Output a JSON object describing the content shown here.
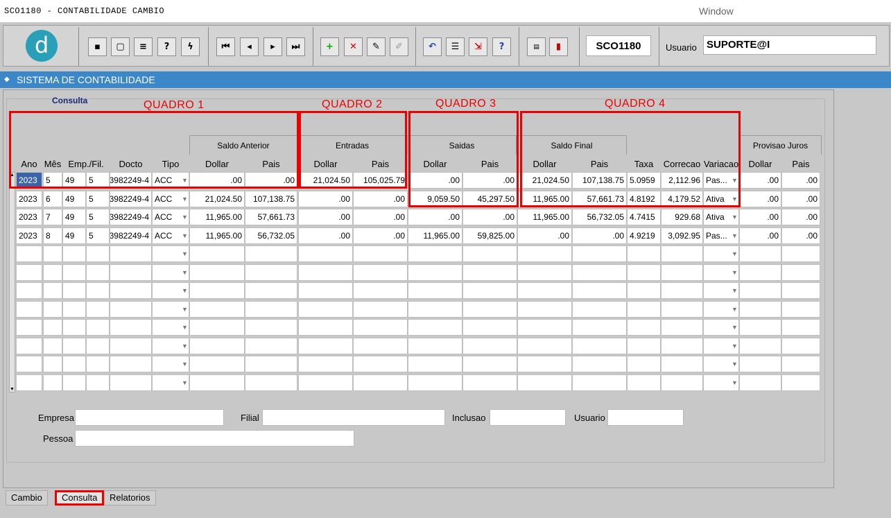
{
  "app_title": "SCO1180 - CONTABILIDADE CAMBIO",
  "window_menu": "Window",
  "toolbar": {
    "form_code": "SCO1180",
    "user_label": "Usuario",
    "user_value": "SUPORTE@I",
    "buttons": [
      "save-icon",
      "print-preview-icon",
      "printer-icon",
      "query-help-icon",
      "execute-query-icon",
      "first-record-icon",
      "previous-record-icon",
      "next-record-icon",
      "last-record-icon",
      "insert-record-icon",
      "delete-record-icon",
      "edit-record-icon",
      "clear-icon",
      "undo-icon",
      "list-icon",
      "exit-form-icon",
      "help-icon",
      "menu-icon",
      "door-exit-icon"
    ]
  },
  "banner_title": "SISTEMA DE CONTABILIDADE",
  "section_label": "Consulta",
  "quadros": [
    "QUADRO 1",
    "QUADRO 2",
    "QUADRO 3",
    "QUADRO 4"
  ],
  "group_headers": [
    "Saldo Anterior",
    "Entradas",
    "Saidas",
    "Saldo Final",
    "Provisao Juros"
  ],
  "columns": [
    "Ano",
    "Mês",
    "Emp./Fil.",
    "Docto",
    "Tipo",
    "Dollar",
    "Pais",
    "Dollar",
    "Pais",
    "Dollar",
    "Pais",
    "Dollar",
    "Pais",
    "Taxa",
    "Correcao",
    "Variacao",
    "Dollar",
    "Pais"
  ],
  "rows": [
    [
      "2023",
      "5",
      "49",
      "5",
      "3982249-4",
      "ACC",
      ".00",
      ".00",
      "21,024.50",
      "105,025.79",
      ".00",
      ".00",
      "21,024.50",
      "107,138.75",
      "5.0959",
      "2,112.96",
      "Pas...",
      ".00",
      ".00"
    ],
    [
      "2023",
      "6",
      "49",
      "5",
      "3982249-4",
      "ACC",
      "21,024.50",
      "107,138.75",
      ".00",
      ".00",
      "9,059.50",
      "45,297.50",
      "11,965.00",
      "57,661.73",
      "4.8192",
      "4,179.52",
      "Ativa",
      ".00",
      ".00"
    ],
    [
      "2023",
      "7",
      "49",
      "5",
      "3982249-4",
      "ACC",
      "11,965.00",
      "57,661.73",
      ".00",
      ".00",
      ".00",
      ".00",
      "11,965.00",
      "56,732.05",
      "4.7415",
      "929.68",
      "Ativa",
      ".00",
      ".00"
    ],
    [
      "2023",
      "8",
      "49",
      "5",
      "3982249-4",
      "ACC",
      "11,965.00",
      "56,732.05",
      ".00",
      ".00",
      "11,965.00",
      "59,825.00",
      ".00",
      ".00",
      "4.9219",
      "3,092.95",
      "Pas...",
      ".00",
      ".00"
    ]
  ],
  "bottom": {
    "empresa_label": "Empresa",
    "filial_label": "Filial",
    "inclusao_label": "Inclusao",
    "usuario_label": "Usuario",
    "pessoa_label": "Pessoa"
  },
  "tabs": [
    "Cambio",
    "Consulta",
    "Relatorios"
  ],
  "colors": {
    "banner": "#3b87c8",
    "highlight": "#e00000",
    "logo": "#2aa0b8"
  }
}
